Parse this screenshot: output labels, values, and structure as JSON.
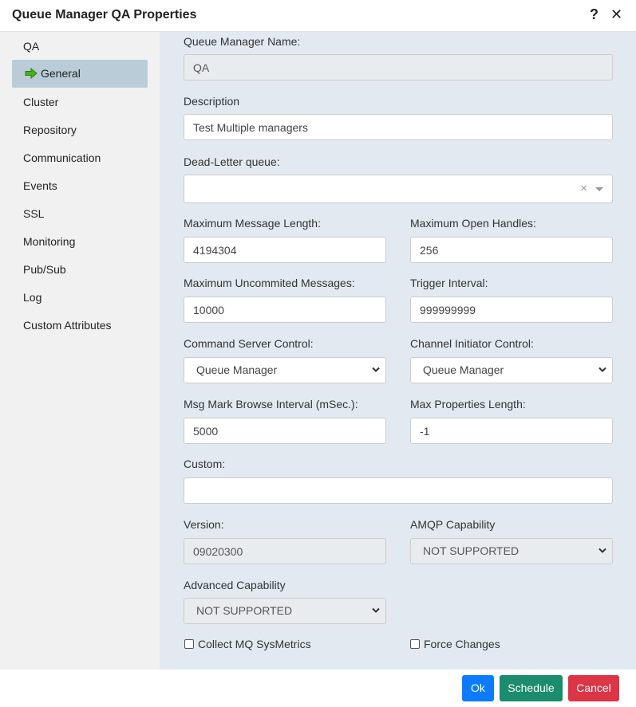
{
  "dialog": {
    "title": "Queue Manager QA Properties"
  },
  "sidebar": {
    "items": [
      {
        "label": "QA"
      },
      {
        "label": "General"
      },
      {
        "label": "Cluster"
      },
      {
        "label": "Repository"
      },
      {
        "label": "Communication"
      },
      {
        "label": "Events"
      },
      {
        "label": "SSL"
      },
      {
        "label": "Monitoring"
      },
      {
        "label": "Pub/Sub"
      },
      {
        "label": "Log"
      },
      {
        "label": "Custom Attributes"
      }
    ]
  },
  "form": {
    "qm_name": {
      "label": "Queue Manager Name:",
      "value": "QA"
    },
    "description": {
      "label": "Description",
      "value": "Test Multiple managers"
    },
    "dlq": {
      "label": "Dead-Letter queue:",
      "value": ""
    },
    "max_msg_len": {
      "label": "Maximum Message Length:",
      "value": "4194304"
    },
    "max_handles": {
      "label": "Maximum Open Handles:",
      "value": "256"
    },
    "max_uncommitted": {
      "label": "Maximum Uncommited Messages:",
      "value": "10000"
    },
    "trigger_interval": {
      "label": "Trigger Interval:",
      "value": "999999999"
    },
    "cmd_server": {
      "label": "Command Server Control:",
      "value": "Queue Manager"
    },
    "chl_init": {
      "label": "Channel Initiator Control:",
      "value": "Queue Manager"
    },
    "mark_browse": {
      "label": "Msg Mark Browse Interval (mSec.):",
      "value": "5000"
    },
    "max_props": {
      "label": "Max Properties Length:",
      "value": "-1"
    },
    "custom": {
      "label": "Custom:",
      "value": ""
    },
    "version": {
      "label": "Version:",
      "value": "09020300"
    },
    "amqp": {
      "label": "AMQP Capability",
      "value": "NOT SUPPORTED"
    },
    "advanced": {
      "label": "Advanced Capability",
      "value": "NOT SUPPORTED"
    },
    "sysmetrics": {
      "label": "Collect MQ SysMetrics"
    },
    "force": {
      "label": "Force Changes"
    }
  },
  "footer": {
    "ok": "Ok",
    "schedule": "Schedule",
    "cancel": "Cancel"
  }
}
